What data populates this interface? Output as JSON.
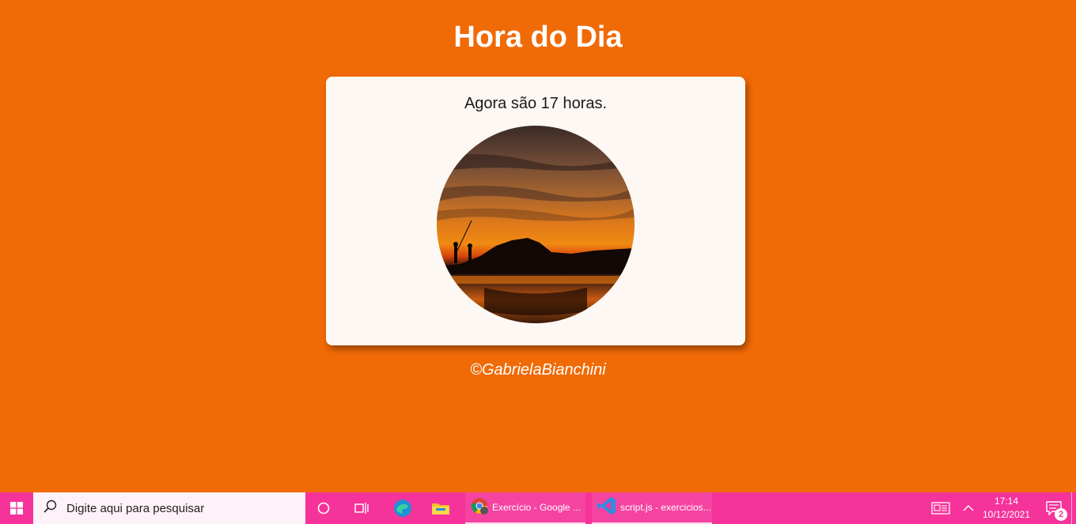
{
  "page": {
    "title": "Hora do Dia",
    "message": "Agora são 17 horas.",
    "image_alt": "sunset-photo",
    "credit": "©GabrielaBianchini",
    "colors": {
      "background": "#f06a06",
      "card": "#fdf8f3",
      "text": "#ffffff"
    }
  },
  "taskbar": {
    "search_placeholder": "Digite aqui para pesquisar",
    "apps": [
      {
        "label": "Exercício - Google ...",
        "icon": "chrome-icon"
      },
      {
        "label": "script.js - exercicios...",
        "icon": "vscode-icon"
      }
    ],
    "pinned_icons": [
      "cortana-icon",
      "task-view-icon",
      "edge-icon",
      "file-explorer-icon"
    ],
    "clock_time": "17:14",
    "clock_date": "10/12/2021",
    "notification_count": "2",
    "color": "#f5339a"
  }
}
